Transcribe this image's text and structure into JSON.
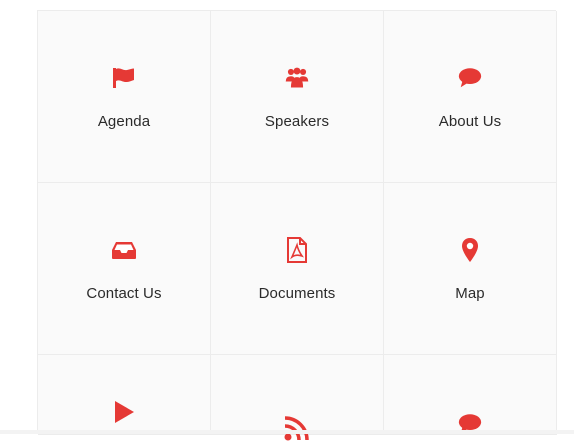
{
  "accent_color": "#e53935",
  "tiles": [
    {
      "label": "Agenda",
      "icon": "flag-icon"
    },
    {
      "label": "Speakers",
      "icon": "users-icon"
    },
    {
      "label": "About Us",
      "icon": "chat-bubble-icon"
    },
    {
      "label": "Contact Us",
      "icon": "inbox-icon"
    },
    {
      "label": "Documents",
      "icon": "pdf-file-icon"
    },
    {
      "label": "Map",
      "icon": "map-marker-icon"
    },
    {
      "label": "",
      "icon": "play-icon"
    },
    {
      "label": "",
      "icon": "rss-icon"
    },
    {
      "label": "",
      "icon": "chat-bubble-icon"
    }
  ]
}
